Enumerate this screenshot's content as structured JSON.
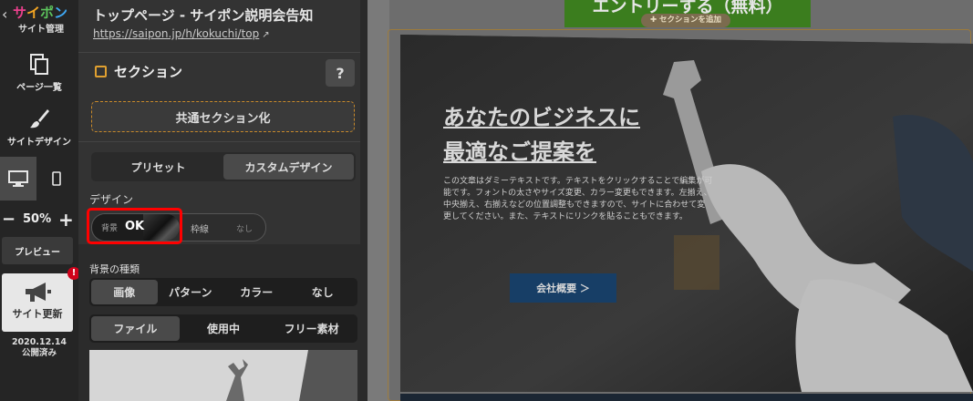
{
  "rail": {
    "logo_parts": [
      "サ",
      "イ",
      "ポ",
      "ン"
    ],
    "logo_sub": "サイト管理",
    "pages_label": "ページ一覧",
    "design_label": "サイトデザイン",
    "zoom_minus": "−",
    "zoom_value": "50%",
    "zoom_plus": "+",
    "preview_label": "プレビュー",
    "update_label": "サイト更新",
    "badge": "!",
    "published_date": "2020.12.14",
    "published_status": "公開済み"
  },
  "panel": {
    "page_title": "トップページ - サイポン説明会告知",
    "page_url": "https://saipon.jp/h/kokuchi/top",
    "section_title": "セクション",
    "help": "?",
    "common_section_button": "共通セクション化",
    "mode_tabs": [
      "プリセット",
      "カスタムデザイン"
    ],
    "design_label": "デザイン",
    "bg_label": "背景",
    "bg_value": "OK",
    "border_label": "枠線",
    "border_value": "なし",
    "bg_type_label": "背景の種類",
    "bg_type_tabs": [
      "画像",
      "パターン",
      "カラー",
      "なし"
    ],
    "source_tabs": [
      "ファイル",
      "使用中",
      "フリー素材"
    ]
  },
  "canvas": {
    "entry_button": "エントリーする（無料）",
    "add_section": "✚ セクションを追加",
    "hero_title_1": "あなたのビジネスに",
    "hero_title_2": "最適なご提案を",
    "hero_body": "この文章はダミーテキストです。テキストをクリックすることで編集が可能です。フォントの太さやサイズ変更、カラー変更もできます。左揃え、中央揃え、右揃えなどの位置調整もできますので、サイトに合わせて変更してください。また、テキストにリンクを貼ることもできます。",
    "cta_label": "会社概要 ＞"
  },
  "colors": {
    "accent_orange": "#c98a2a",
    "highlight_red": "#ff0000",
    "entry_green": "#3b7d1e",
    "cta_blue": "#173e66"
  }
}
